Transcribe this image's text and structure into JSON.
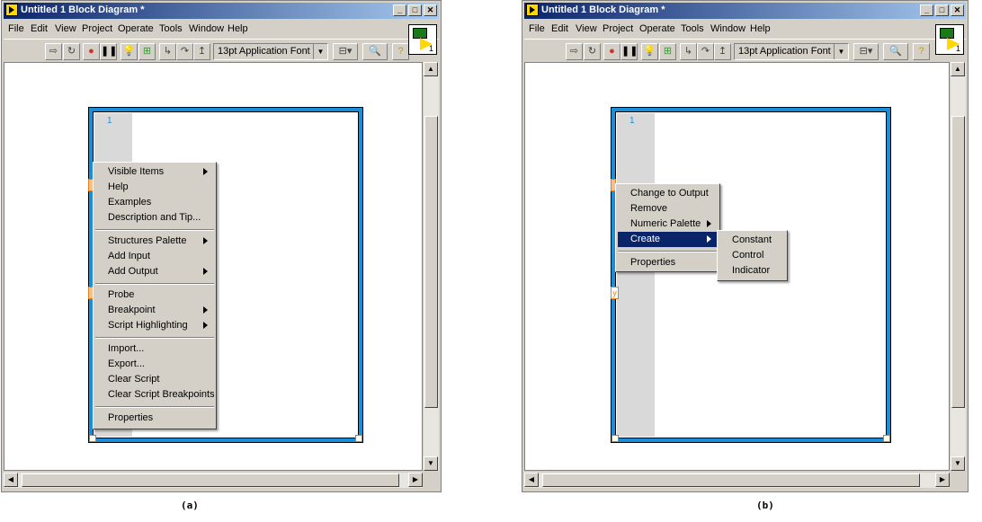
{
  "window_title": "Untitled 1 Block Diagram *",
  "menu": [
    "File",
    "Edit",
    "View",
    "Project",
    "Operate",
    "Tools",
    "Window",
    "Help"
  ],
  "font_selector": "13pt Application Font",
  "frame_number": "1",
  "vi_icon_number": "1",
  "panel_a": {
    "caption": "(a)",
    "context_menu": [
      {
        "label": "Visible Items",
        "submenu": true
      },
      {
        "label": "Help"
      },
      {
        "label": "Examples"
      },
      {
        "label": "Description and Tip..."
      },
      {
        "label": "Structures Palette",
        "submenu": true
      },
      {
        "label": "Add Input"
      },
      {
        "label": "Add Output",
        "submenu": true
      },
      {
        "label": "Probe"
      },
      {
        "label": "Breakpoint",
        "submenu": true
      },
      {
        "label": "Script Highlighting",
        "submenu": true
      },
      {
        "label": "Import..."
      },
      {
        "label": "Export..."
      },
      {
        "label": "Clear Script"
      },
      {
        "label": "Clear Script Breakpoints"
      },
      {
        "label": "Properties"
      }
    ]
  },
  "panel_b": {
    "caption": "(b)",
    "node_label": "y",
    "context_menu": [
      {
        "label": "Change to Output"
      },
      {
        "label": "Remove"
      },
      {
        "label": "Numeric Palette",
        "submenu": true
      },
      {
        "label": "Create",
        "submenu": true,
        "highlighted": true
      },
      {
        "label": "Properties"
      }
    ],
    "create_submenu": [
      "Constant",
      "Control",
      "Indicator"
    ]
  },
  "colors": {
    "titlebar_start": "#0a246a",
    "structure_border": "#1a8fd8",
    "menu_highlight": "#0a246a"
  }
}
